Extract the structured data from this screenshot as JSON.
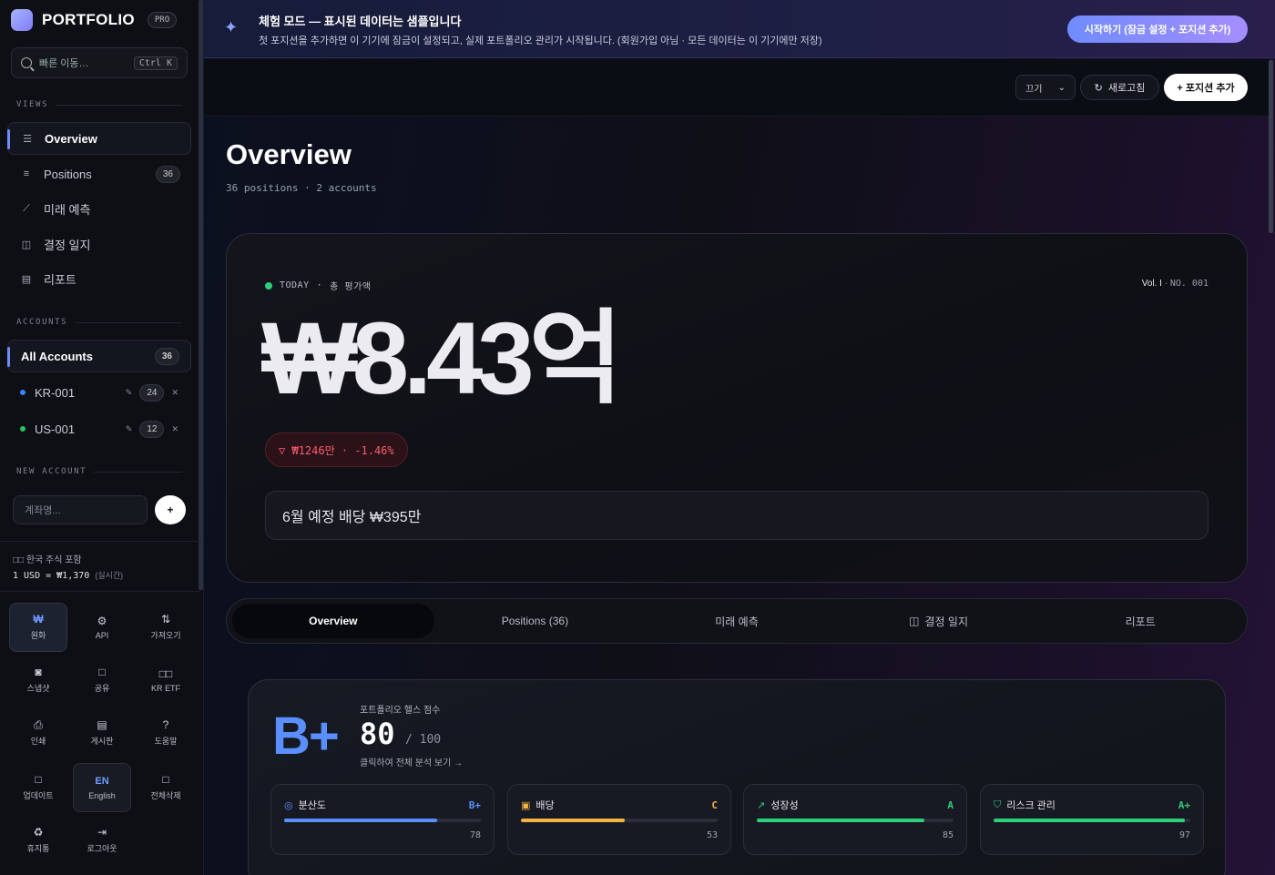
{
  "brand": {
    "name": "PORTFOLIO",
    "badge": "PRO"
  },
  "search": {
    "placeholder": "빠른 이동…",
    "shortcut": "Ctrl K"
  },
  "sidebar": {
    "views_label": "VIEWS",
    "views": [
      {
        "label": "Overview",
        "icon": "list-icon",
        "active": true
      },
      {
        "label": "Positions",
        "icon": "menu-icon",
        "count": "36"
      },
      {
        "label": "미래 예측",
        "icon": "trend-icon"
      },
      {
        "label": "결정 일지",
        "icon": "book-icon"
      },
      {
        "label": "리포트",
        "icon": "doc-icon"
      }
    ],
    "accounts_label": "ACCOUNTS",
    "all_accounts": {
      "label": "All Accounts",
      "count": "36"
    },
    "accounts": [
      {
        "name": "KR-001",
        "count": "24",
        "color": "#3b82f6"
      },
      {
        "name": "US-001",
        "count": "12",
        "color": "#22c55e"
      }
    ],
    "new_account_label": "NEW ACCOUNT",
    "new_account_placeholder": "계좌명...",
    "new_account_button": "+",
    "fx_note": "□□ 한국 주식 포함",
    "fx_rate": "1 USD = ₩1,370",
    "fx_live": "(실시간)",
    "tools": [
      {
        "label": "원화",
        "icon": "₩",
        "sel": true
      },
      {
        "label": "API",
        "icon": "⚙"
      },
      {
        "label": "가져오기",
        "icon": "⇅"
      },
      {
        "label": "스냅샷",
        "icon": "◙"
      },
      {
        "label": "공유",
        "icon": "□"
      },
      {
        "label": "KR ETF",
        "icon": "□□"
      },
      {
        "label": "인쇄",
        "icon": "⎙"
      },
      {
        "label": "게시판",
        "icon": "▤"
      },
      {
        "label": "도움말",
        "icon": "?"
      },
      {
        "label": "업데이트",
        "icon": "□"
      },
      {
        "label": "English",
        "icon": "EN",
        "lang": true
      },
      {
        "label": "전체삭제",
        "icon": "□"
      },
      {
        "label": "휴지통",
        "icon": "♻"
      },
      {
        "label": "로그아웃",
        "icon": "⇥"
      }
    ]
  },
  "banner": {
    "title": "체험 모드 — 표시된 데이터는 샘플입니다",
    "subtitle": "첫 포지션을 추가하면 이 기기에 잠금이 설정되고, 실제 포트폴리오 관리가 시작됩니다. (회원가입 아님 · 모든 데이터는 이 기기에만 저장)",
    "button": "시작하기 (잠금 설정 + 포지션 추가)"
  },
  "topbar": {
    "select_value": "끄기",
    "refresh": "새로고침",
    "add": "+ 포지션 추가"
  },
  "page": {
    "title": "Overview",
    "subtitle": "36 positions · 2 accounts"
  },
  "hero": {
    "today": "TODAY",
    "today_label": "총 평가액",
    "vol": "Vol. I",
    "no": "NO. 001",
    "amount": "₩8.43억",
    "change": "▽ ₩1246만 · -1.46%",
    "dividend": "6월 예정 배당 ₩395만"
  },
  "tabs": [
    {
      "label": "Overview",
      "active": true
    },
    {
      "label": "Positions (36)"
    },
    {
      "label": "미래 예측"
    },
    {
      "label": "결정 일지",
      "icon": "book-icon"
    },
    {
      "label": "리포트"
    }
  ],
  "health": {
    "grade": "B+",
    "label": "포트폴리오 헬스 점수",
    "score": "80",
    "max": "/ 100",
    "link": "클릭하여 전체 분석 보기 →",
    "metrics": [
      {
        "label": "분산도",
        "grade": "B+",
        "value": "78",
        "pct": 78,
        "color": "#5b8fff",
        "icon": "◎"
      },
      {
        "label": "배당",
        "grade": "C",
        "value": "53",
        "pct": 53,
        "color": "#f5b442",
        "icon": "▣"
      },
      {
        "label": "성장성",
        "grade": "A",
        "value": "85",
        "pct": 85,
        "color": "#2ecf7a",
        "icon": "↗"
      },
      {
        "label": "리스크 관리",
        "grade": "A+",
        "value": "97",
        "pct": 97,
        "color": "#2ecf7a",
        "icon": "⛉"
      }
    ]
  }
}
